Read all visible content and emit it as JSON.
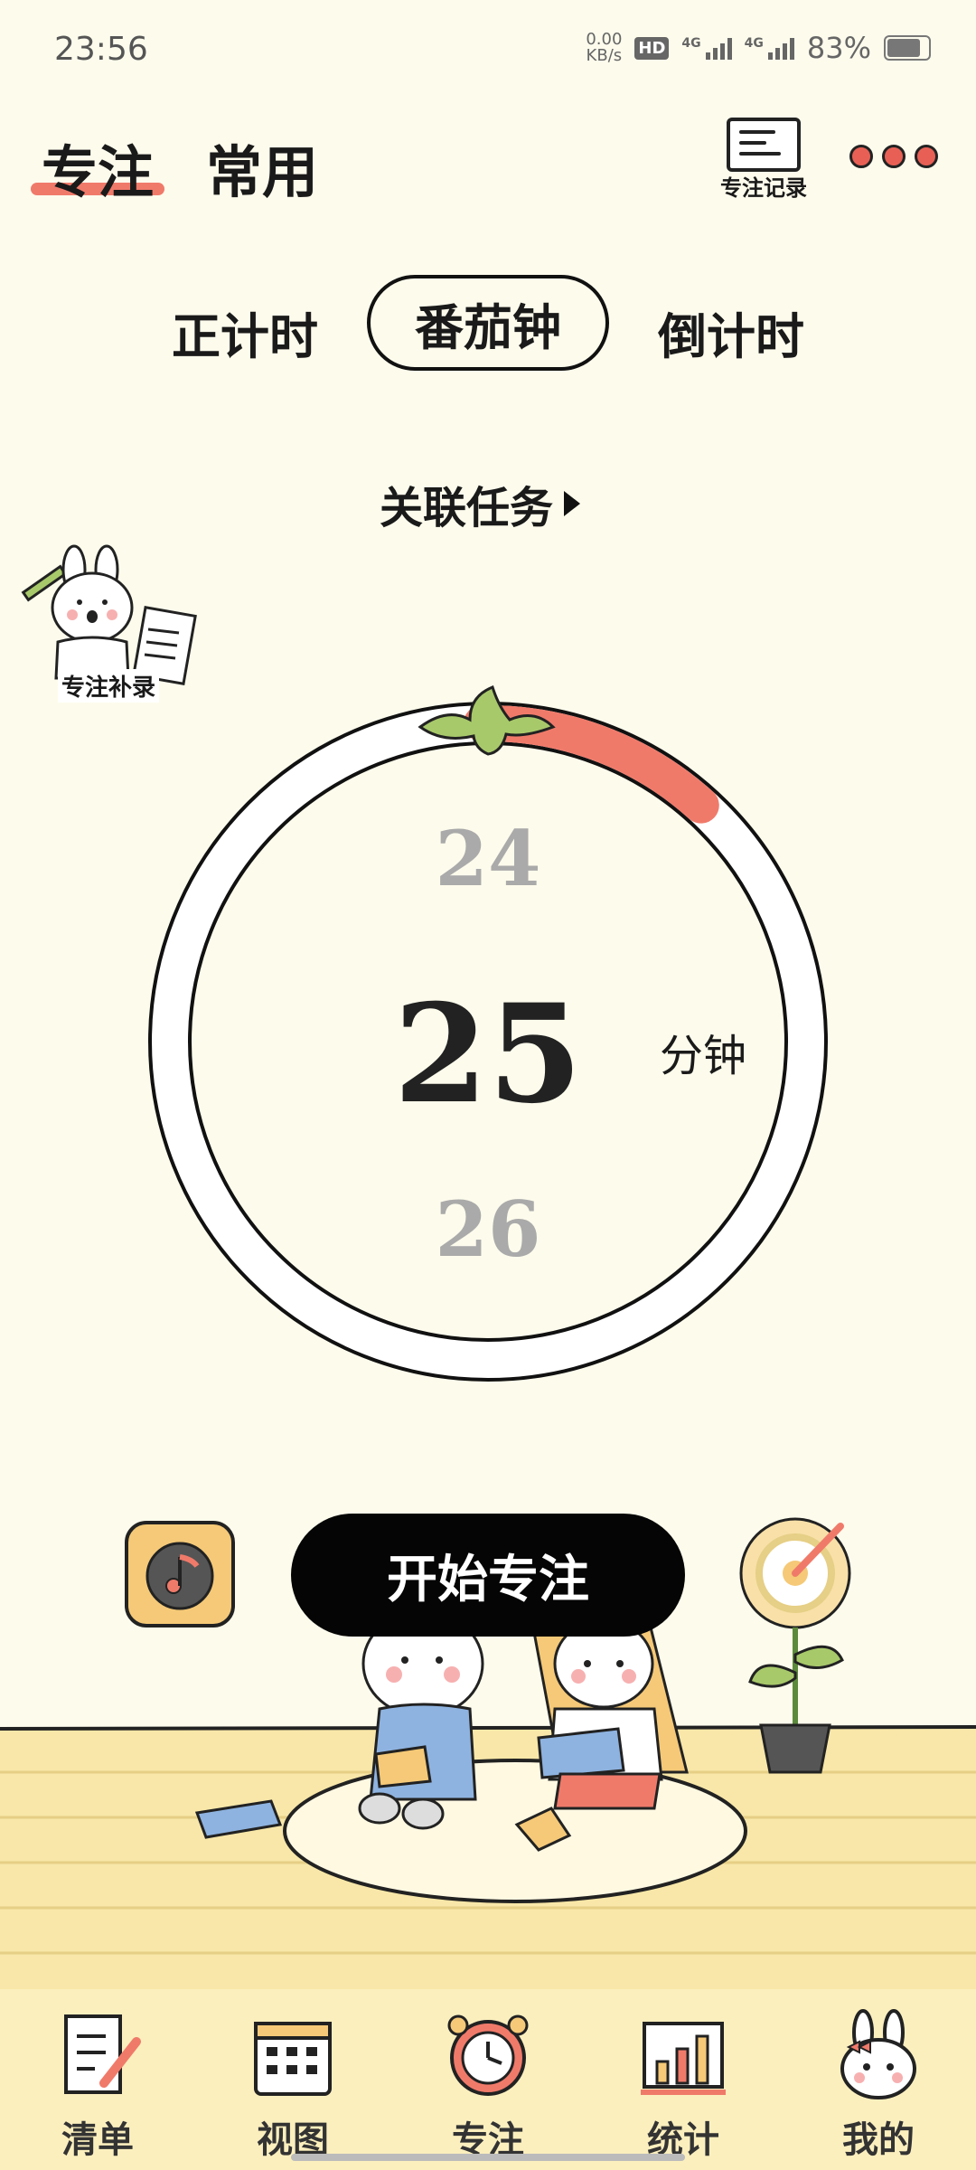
{
  "status_bar": {
    "time": "23:56",
    "net_speed_value": "0.00",
    "net_speed_unit": "KB/s",
    "hd_label": "HD",
    "signal1_label": "4G",
    "signal2_label": "4G",
    "battery": "83%"
  },
  "header": {
    "tabs": [
      {
        "label": "专注",
        "active": true
      },
      {
        "label": "常用",
        "active": false
      }
    ],
    "record_label": "专注记录",
    "more_icon": "more-dots-icon"
  },
  "modes": {
    "forward_label": "正计时",
    "tomato_label": "番茄钟",
    "countdown_label": "倒计时",
    "selected": "番茄钟"
  },
  "linked_task_label": "关联任务",
  "supplement_label": "专注补录",
  "timer": {
    "prev_value": "24",
    "current_value": "25",
    "next_value": "26",
    "unit": "分钟",
    "progress_arc_fraction": 0.12
  },
  "controls": {
    "music_icon": "music-note-icon",
    "start_label": "开始专注",
    "goal_icon": "target-flower-icon"
  },
  "bottom_nav": [
    {
      "label": "清单",
      "icon": "list-icon"
    },
    {
      "label": "视图",
      "icon": "calendar-icon"
    },
    {
      "label": "专注",
      "icon": "alarm-clock-icon",
      "active": true
    },
    {
      "label": "统计",
      "icon": "bar-chart-icon"
    },
    {
      "label": "我的",
      "icon": "bunny-icon"
    }
  ],
  "colors": {
    "background": "#FDFBEC",
    "accent": "#F07A6A",
    "nav_background": "#FBEFBE"
  }
}
